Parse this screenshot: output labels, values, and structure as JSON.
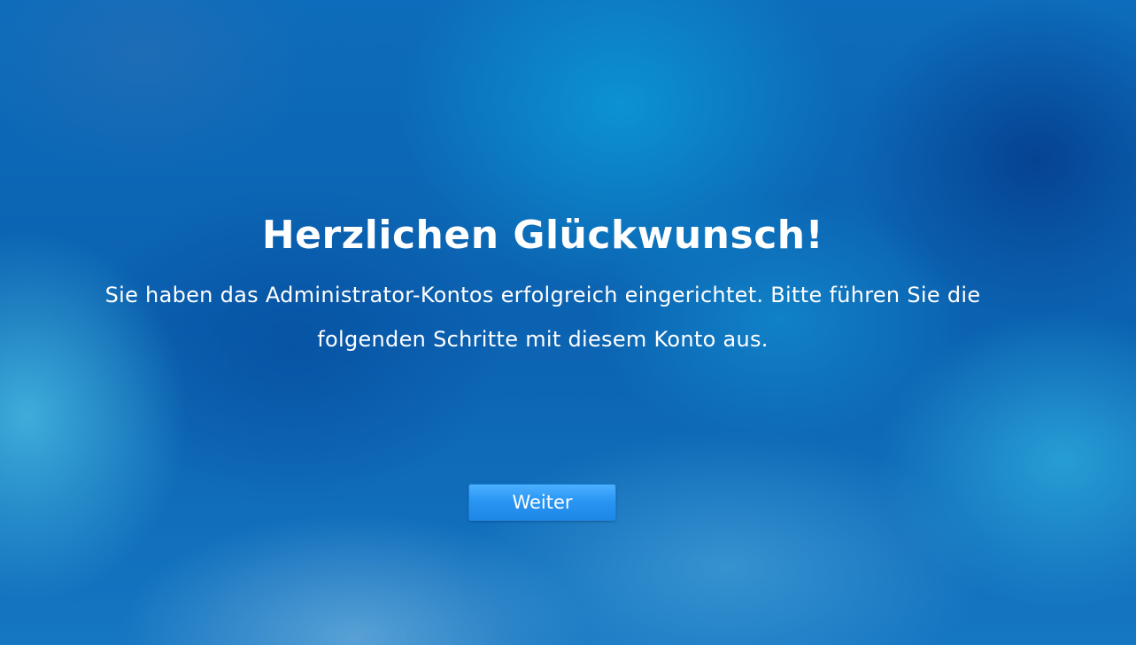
{
  "setup": {
    "title": "Herzlichen Glückwunsch!",
    "message": "Sie haben das Administrator-Kontos erfolgreich eingerichtet. Bitte führen Sie die folgenden Schritte mit diesem Konto aus.",
    "continue_label": "Weiter"
  },
  "colors": {
    "background": "#0a6ab8",
    "button": "#2a96f4",
    "text": "#ffffff"
  }
}
